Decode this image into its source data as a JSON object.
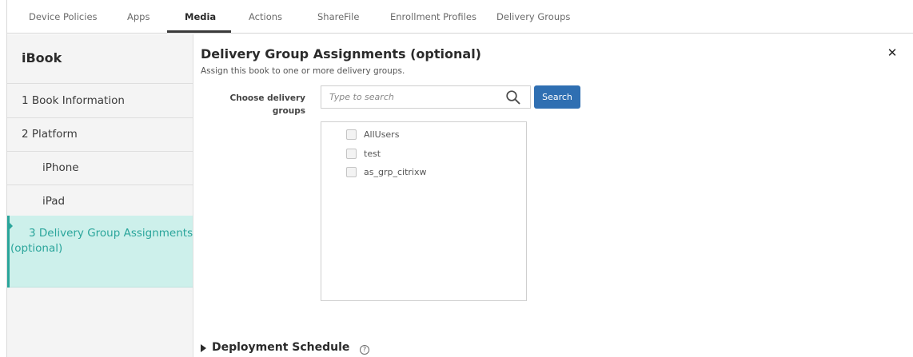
{
  "tabs": [
    {
      "label": "Device Policies",
      "active": false
    },
    {
      "label": "Apps",
      "active": false
    },
    {
      "label": "Media",
      "active": true
    },
    {
      "label": "Actions",
      "active": false
    },
    {
      "label": "ShareFile",
      "active": false
    },
    {
      "label": "Enrollment Profiles",
      "active": false
    },
    {
      "label": "Delivery Groups",
      "active": false
    }
  ],
  "sidebar": {
    "title": "iBook",
    "items": [
      {
        "label": "1  Book Information"
      },
      {
        "label": "2  Platform"
      },
      {
        "label": "iPhone"
      },
      {
        "label": "iPad"
      },
      {
        "label_line1": "3  Delivery Group Assignments",
        "label_line2": "(optional)",
        "active": true
      }
    ]
  },
  "main": {
    "title": "Delivery Group Assignments (optional)",
    "subtitle": "Assign this book to one or more delivery groups.",
    "field_label": "Choose delivery groups",
    "search": {
      "placeholder": "Type to search",
      "value": ""
    },
    "search_button": "Search",
    "groups": [
      {
        "label": "AllUsers",
        "checked": false
      },
      {
        "label": "test",
        "checked": false
      },
      {
        "label": "as_grp_citrixw",
        "checked": false
      }
    ],
    "deployment_schedule": "Deployment Schedule"
  },
  "icons": {
    "close": "close-icon",
    "search": "search-icon",
    "help": "help-icon",
    "expand": "triangle-right-icon"
  },
  "colors": {
    "accent": "#2aa59b",
    "active_bg": "#cdf0eb",
    "button": "#2f6fb2"
  }
}
